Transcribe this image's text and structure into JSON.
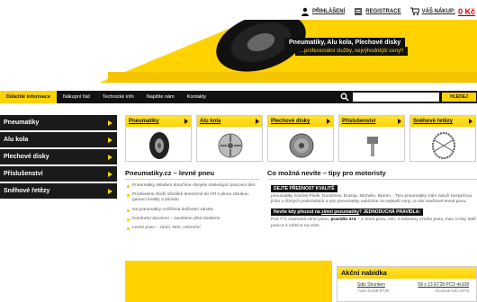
{
  "header": {
    "login": "PŘIHLÁŠENÍ",
    "register": "REGISTRACE",
    "cart": "VÁŠ NÁKUP:",
    "cart_price": "0 Kč"
  },
  "banner": {
    "slogan_main": "Pneumatiky, Alu kola, Plechové disky",
    "slogan_sub": "...profesionální služby, nejvýhodnější ceny!!"
  },
  "nav": {
    "items": [
      "Důležité informace",
      "Nákupní řád",
      "Technické info",
      "Napište nám",
      "Kontakty"
    ],
    "search_button": "HLEDEJ"
  },
  "sidebar": {
    "items": [
      "Pneumatiky",
      "Alu kola",
      "Plechové disky",
      "Příslušenství",
      "Sněhové řetězy"
    ]
  },
  "categories": [
    "Pneumatiky",
    "Alu kola",
    "Plechové disky",
    "Příslušenství",
    "Sněhové řetězy"
  ],
  "col1": {
    "title": "Pneumatiky.cz – levné pneu",
    "bullets": [
      "Pneumatiky skladem doručíme obvykle následující pracovní den",
      "Prodáváme zboží oficiálně dovezené do ČR s plnou zárukou, garancí kvality a původu",
      "Na pneumatiky rozšířená doživotní záruka",
      "Komfortní doručení – zavoláme před dodáním",
      "Levné pneu – zimní, letní, celoroční"
    ]
  },
  "col2": {
    "title": "Co možná nevíte – tipy pro motoristy",
    "tag1": "DEJTE PŘEDNOST KVALITĚ",
    "text1": "pneumatiky značek Pirelli, GoodYear, Dunlop, Michelin, Barum... Tyto pneumatiky Vám zaručí bezpečnou jízdu v různých podmínkách a tyto pneumatiky nabízíme za nejlepší ceny. U nás značkové levné pneu.",
    "tag2_a": "Nevíte kdy přezout na",
    "tag2_link": "zimní pneumatiky",
    "tag2_b": "? JEDNODUCHÁ PRAVIDLA:",
    "text2_a": "Pod 7°C znamená zimní pneu,",
    "text2_rule": "pravidlo 4+4",
    "text2_b": "– 4 zimní pneu, min. 4 milimetry vzorku pneu, max 4 roky stáří pneu a 4 měsíce na voze."
  },
  "offer": {
    "title": "Akční nabídka",
    "item1": "Sdiz Shunken",
    "item1_sub": "7x16 4x108 ET30",
    "item2": "58 x 13 ET28 PCD 4x108",
    "item2_sub": "Ocelové kolo 4075"
  },
  "colors": {
    "accent": "#ffd200",
    "dark": "#111111",
    "price": "#e00000"
  }
}
